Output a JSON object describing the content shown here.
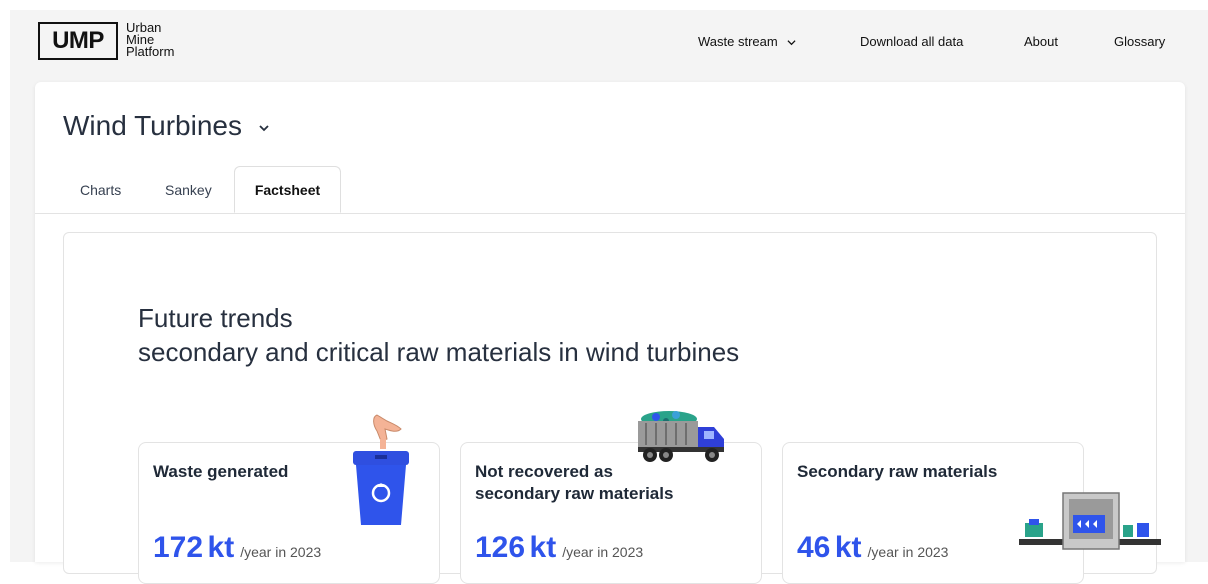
{
  "logo": {
    "mark": "UMP",
    "line1": "Urban",
    "line2": "Mine",
    "line3": "Platform"
  },
  "nav": {
    "waste_stream": "Waste stream",
    "download": "Download all data",
    "about": "About",
    "glossary": "Glossary"
  },
  "page": {
    "title": "Wind Turbines"
  },
  "tabs": [
    {
      "label": "Charts"
    },
    {
      "label": "Sankey"
    },
    {
      "label": "Factsheet",
      "active": true
    }
  ],
  "factsheet": {
    "heading_line1": "Future trends",
    "heading_line2": "secondary and critical raw materials in wind turbines",
    "stats": [
      {
        "label": "Waste generated",
        "value": "172",
        "unit": "kt",
        "suffix": "/year in 2023",
        "icon": "recycling-bin-icon"
      },
      {
        "label": "Not recovered as secondary raw materials",
        "value": "126",
        "unit": "kt",
        "suffix": "/year in 2023",
        "icon": "dump-truck-icon"
      },
      {
        "label": "Secondary raw materials",
        "value": "46",
        "unit": "kt",
        "suffix": "/year in 2023",
        "icon": "recycling-machine-icon"
      }
    ]
  },
  "colors": {
    "accent": "#2f54eb",
    "text": "#27303f",
    "border": "#e3e3e3"
  }
}
